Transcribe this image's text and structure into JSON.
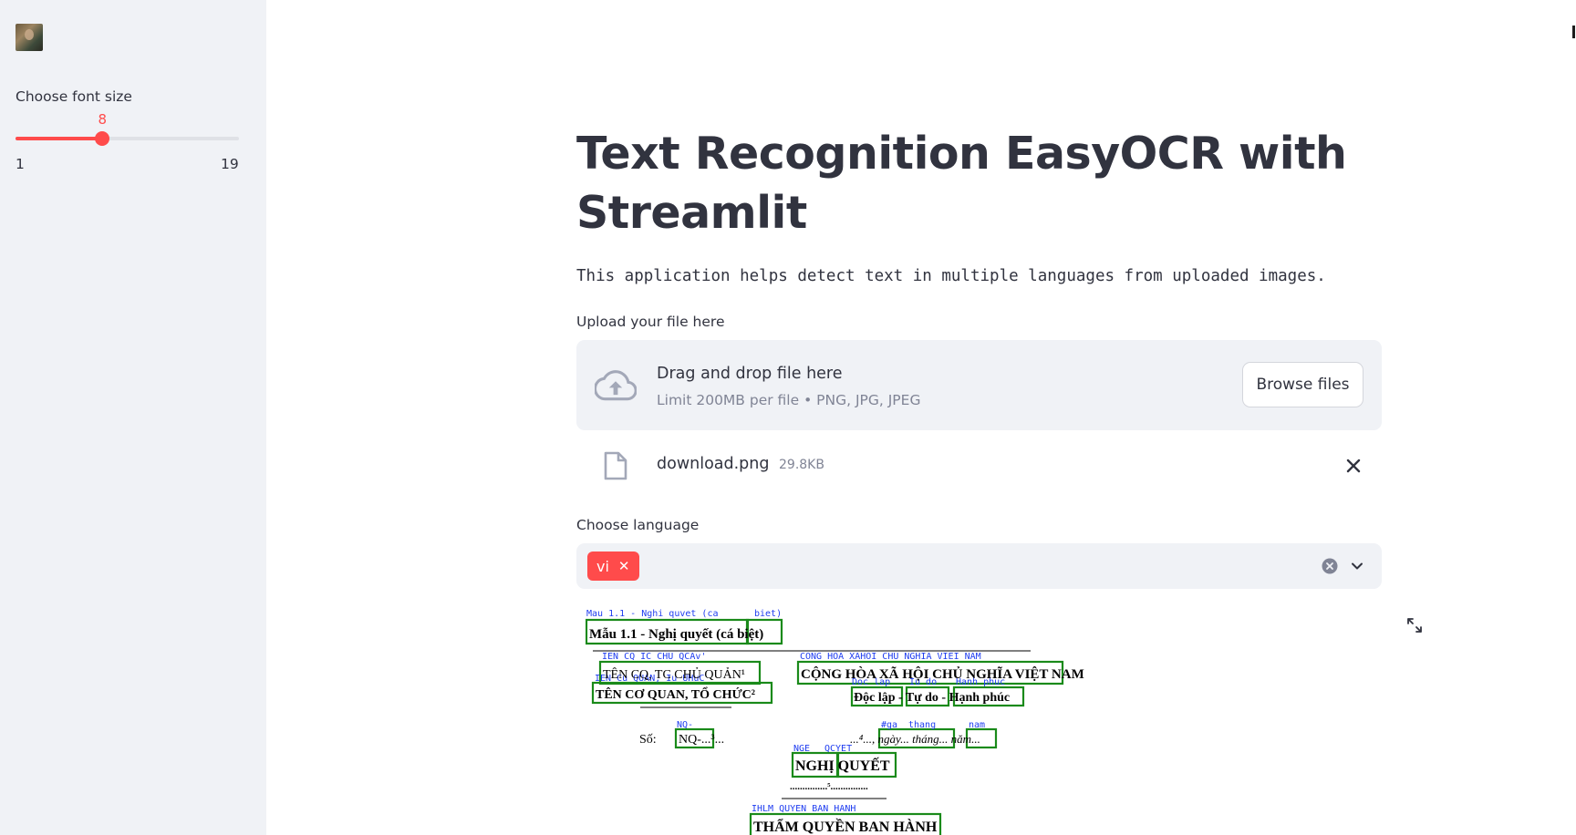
{
  "sidebar": {
    "slider": {
      "label": "Choose font size",
      "value": "8",
      "min": "1",
      "max": "19",
      "fraction": 0.3889
    }
  },
  "main": {
    "title": "Text Recognition EasyOCR with Streamlit",
    "subtitle": "This application helps detect text in multiple languages from uploaded images.",
    "uploader": {
      "label": "Upload your file here",
      "drop_text": "Drag and drop file here",
      "limit_text": "Limit 200MB per file • PNG, JPG, JPEG",
      "browse_label": "Browse files"
    },
    "file": {
      "name": "download.png",
      "size": "29.8KB"
    },
    "language": {
      "label": "Choose language",
      "selected": [
        "vi"
      ]
    },
    "result_image": {
      "doc_lines": [
        "Mẫu 1.1 - Nghị quyết (cá biệt)",
        "TÊN CQ, TC CHỦ QUẢN¹",
        "TÊN CƠ QUAN, TỔ CHỨC²",
        "CỘNG HÒA XÃ HỘI CHỦ NGHĨA VIỆT NAM",
        "Độc lập - Tự do - Hạnh phúc",
        "Số:",
        "NQ-...³...",
        "...⁴..., ngày... tháng... năm...",
        "NGHỊ QUYẾT",
        "...............⁵...............",
        "THẨM QUYỀN BAN HÀNH"
      ],
      "ocr_labels": [
        "Mau 1.1 - Nghi quvet (ca",
        "biet)",
        "IEN CQ IC CHU QCAv'",
        "IEN Cu QUAN, Iu UHuC",
        "CONG HOA XAHOI CHU NGHIA VIEI NAM",
        "Doc lap",
        "Iu do",
        "Hanh phuc",
        "NQ-",
        "#ga",
        "thang",
        "nam",
        "QCYET",
        "NGE",
        "IHLM QUYEN BAN HANH"
      ]
    }
  }
}
